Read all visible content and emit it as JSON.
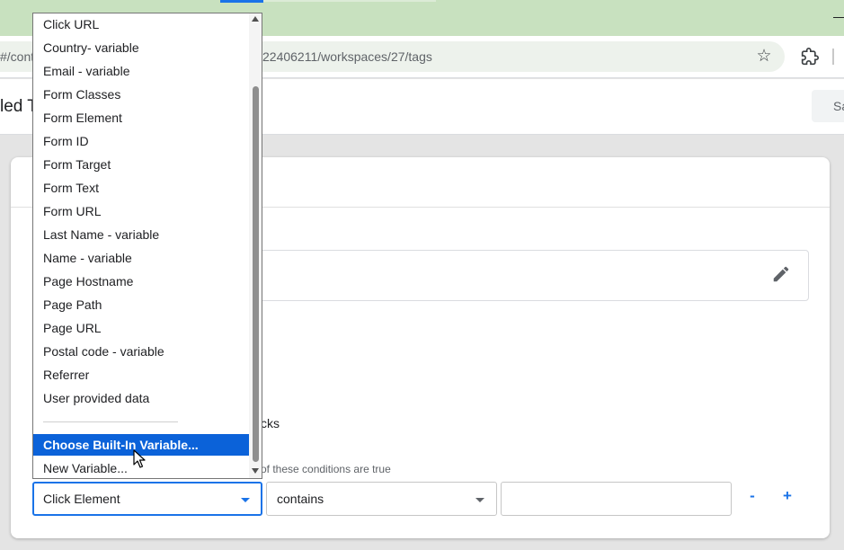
{
  "browser": {
    "url_prefix": "#/cont",
    "url_suffix": "22406211/workspaces/27/tags",
    "star_icon": "star-icon",
    "extension_icon": "puzzle-icon"
  },
  "app": {
    "title": "led T",
    "save_label": "Sa"
  },
  "trigger": {
    "clicks_text": "cks",
    "conditions_text": "of these conditions are true",
    "variable_value": "Click Element",
    "operator_value": "contains",
    "value_field": "",
    "minus_label": "-",
    "plus_label": "+"
  },
  "dropdown": {
    "items": [
      "Click URL",
      "Country- variable",
      "Email - variable",
      "Form Classes",
      "Form Element",
      "Form ID",
      "Form Target",
      "Form Text",
      "Form URL",
      "Last Name - variable",
      "Name - variable",
      "Page Hostname",
      "Page Path",
      "Page URL",
      "Postal code - variable",
      "Referrer",
      "User provided data"
    ],
    "choose_builtin": "Choose Built-In Variable...",
    "new_variable": "New Variable..."
  }
}
